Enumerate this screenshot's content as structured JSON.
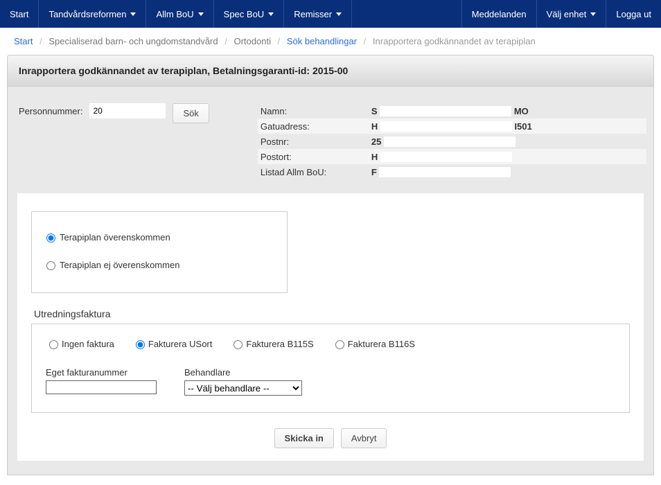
{
  "nav": {
    "left": [
      {
        "label": "Start",
        "dropdown": false
      },
      {
        "label": "Tandvårdsreformen",
        "dropdown": true
      },
      {
        "label": "Allm BoU",
        "dropdown": true
      },
      {
        "label": "Spec BoU",
        "dropdown": true
      },
      {
        "label": "Remisser",
        "dropdown": true
      }
    ],
    "right": [
      {
        "label": "Meddelanden",
        "dropdown": false
      },
      {
        "label": "Välj enhet",
        "dropdown": true
      },
      {
        "label": "Logga ut",
        "dropdown": false
      }
    ]
  },
  "breadcrumb": {
    "items": [
      {
        "label": "Start",
        "link": true
      },
      {
        "label": "Specialiserad barn- och ungdomstandvård",
        "link": false
      },
      {
        "label": "Ortodonti",
        "link": false
      },
      {
        "label": "Sök behandlingar",
        "link": true
      }
    ],
    "current": "Inrapportera godkännandet av terapiplan"
  },
  "title": "Inrapportera godkännandet av terapiplan, Betalningsgaranti-id: 2015-00",
  "personnummer": {
    "label": "Personnummer:",
    "value": "20",
    "search_label": "Sök"
  },
  "info": {
    "namn_label": "Namn:",
    "namn_value_pre": "S",
    "namn_value_post": "MO",
    "gatu_label": "Gatuadress:",
    "gatu_value_pre": "H",
    "gatu_value_post": "I501",
    "postnr_label": "Postnr:",
    "postnr_value": "25",
    "postort_label": "Postort:",
    "postort_value": "H",
    "listad_label": "Listad Allm BoU:",
    "listad_value": "F"
  },
  "plan": {
    "opt1": "Terapiplan överenskommen",
    "opt2": "Terapiplan ej överenskommen"
  },
  "invoice": {
    "section": "Utredningsfaktura",
    "opt1": "Ingen faktura",
    "opt2": "Fakturera USort",
    "opt3": "Fakturera B115S",
    "opt4": "Fakturera B116S",
    "own_num_label": "Eget fakturanummer",
    "own_num_value": "",
    "behandlare_label": "Behandlare",
    "behandlare_selected": "-- Välj behandlare --"
  },
  "actions": {
    "submit": "Skicka in",
    "cancel": "Avbryt"
  }
}
